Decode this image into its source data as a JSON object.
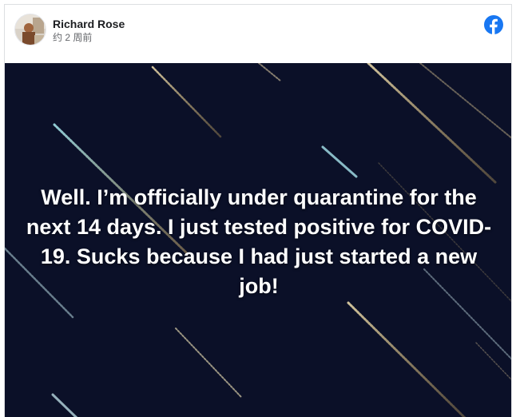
{
  "post": {
    "author": "Richard Rose",
    "timestamp": "约 2 周前",
    "caption": "Well. I’m officially under quarantine for the next 14 days. I just tested positive for COVID-19. Sucks because I had just started a new job!"
  },
  "icons": {
    "platform": "facebook-icon",
    "avatar": "avatar-photo"
  },
  "colors": {
    "facebook_blue": "#1877f2",
    "photo_background": "#0b1028",
    "caption_text": "#ffffff",
    "author_text": "#1c1e21",
    "meta_text": "#65676b"
  }
}
